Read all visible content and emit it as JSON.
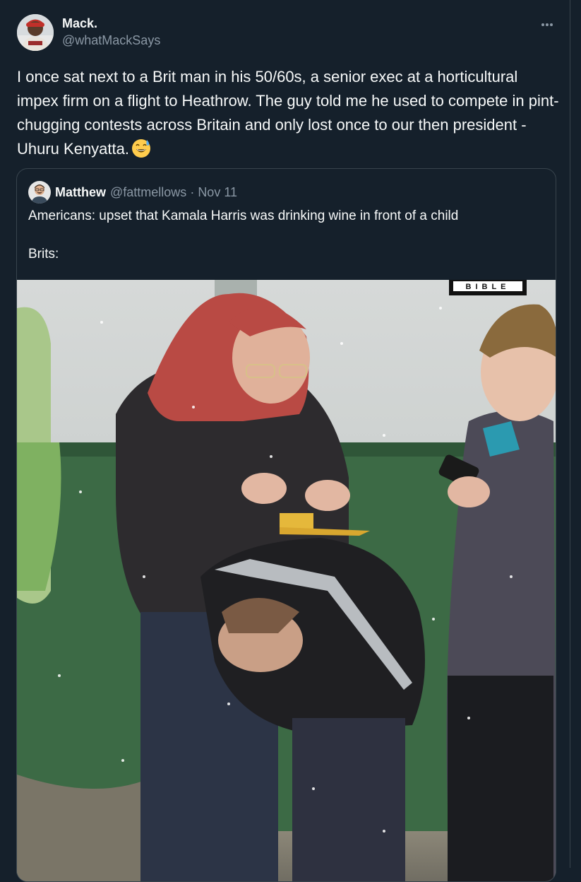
{
  "tweet": {
    "author": {
      "display_name": "Mack.",
      "handle": "@whatMackSays"
    },
    "more_icon": "more-horizontal-icon",
    "text": "I once sat next to a Brit man in his 50/60s, a senior exec at a horticultural impex firm on a flight to Heathrow. The guy told me he used to compete in pint-chugging contests across Britain and only lost once to our then president - Uhuru Kenyatta.",
    "emoji": "grinning-face-with-sweat-emoji"
  },
  "quote": {
    "author": {
      "display_name": "Matthew",
      "handle": "@fattmellows",
      "separator": "·",
      "date": "Nov 11"
    },
    "text_line1": "Americans: upset that Kamala Harris was drinking wine in front of a child",
    "text_line2": "Brits:",
    "media": {
      "watermark": "BIBLE"
    }
  },
  "colors": {
    "background": "#15202b",
    "border": "#38444d",
    "text_primary": "#f7f9f9",
    "text_secondary": "#8b98a5"
  }
}
